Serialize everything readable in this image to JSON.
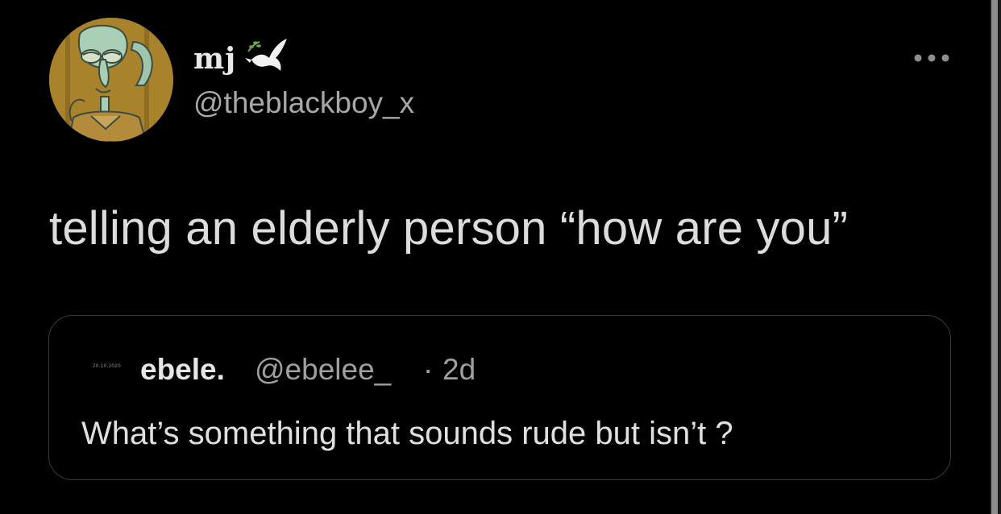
{
  "tweet": {
    "author": {
      "display_name": "mj",
      "handle": "@theblackboy_x",
      "avatar_icon": "squidward-avatar-icon",
      "name_emoji_icon": "dove-icon"
    },
    "more_icon": "ellipsis-icon",
    "text": "telling an elderly person “how are you”"
  },
  "quoted_tweet": {
    "avatar_text": "20.10.2020",
    "display_name": "ebele.",
    "handle": "@ebelee_",
    "separator": "·",
    "time": "2d",
    "text": "What’s something that sounds rude but isn’t ?"
  },
  "colors": {
    "background": "#000000",
    "primary_text": "#dcdcdc",
    "secondary_text": "#a8a8a8",
    "card_border": "#3a3a3a"
  }
}
